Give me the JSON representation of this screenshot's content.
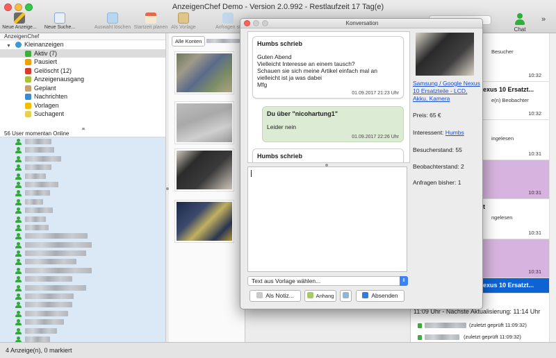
{
  "window": {
    "title": "AnzeigenChef Demo - Version 2.0.992 - Restlaufzeit 17 Tag(e)"
  },
  "toolbar": {
    "items": [
      {
        "label": "Neue Anzeige...",
        "icon": "wand-icon"
      },
      {
        "label": "Neue Suche...",
        "icon": "new-search-icon"
      },
      {
        "label": "Auswahl löschen",
        "icon": "trash-icon"
      },
      {
        "label": "Startzeit planen",
        "icon": "calendar-icon"
      },
      {
        "label": "Als Vorlage",
        "icon": "template-icon"
      },
      {
        "label": "Anfragen st",
        "icon": "send-icon"
      }
    ],
    "chat_label": "Chat",
    "more_label": "»"
  },
  "tree": {
    "header": "AnzeigenChef",
    "root": "Kleinanzeigen",
    "items": [
      {
        "label": "Aktiv (7)",
        "color": "#3fae3a"
      },
      {
        "label": "Pausiert",
        "color": "#f0a000"
      },
      {
        "label": "Gelöscht (12)",
        "color": "#d63a2a"
      },
      {
        "label": "Anzeigenausgang",
        "color": "#a9c23a"
      },
      {
        "label": "Geplant",
        "color": "#c8a06a"
      },
      {
        "label": "Nachrichten",
        "color": "#3a8ad6"
      },
      {
        "label": "Vorlagen",
        "color": "#f0c000"
      },
      {
        "label": "Suchagent",
        "color": "#e8d050"
      }
    ]
  },
  "users": {
    "header": "56 User momentan Online"
  },
  "middle": {
    "accounts_button": "Alle Konten"
  },
  "dialog": {
    "title": "Konversation",
    "messages": [
      {
        "author": "Humbs schrieb",
        "text": "Guten Abend\nVielleicht Interesse an einem tausch?\nSchauen sie sich meine Artikel einfach mal an vielleicht ist ja was dabei\nMfg",
        "time": "01.09.2017 21:23 Uhr"
      },
      {
        "author": "Du über \"nicohartung1\"",
        "text": "Leider nein",
        "time": "01.09.2017 22:26 Uhr"
      },
      {
        "author": "Humbs schrieb",
        "text": "",
        "time": ""
      }
    ],
    "template_select": "Text aus Vorlage wählen...",
    "buttons": {
      "note": "Als Notiz...",
      "attachment": "Anhang",
      "send": "Absenden"
    },
    "product": {
      "link": "Samsung / Google Nexus 10 Ersatzteile - LCD, Akku, Kamera",
      "price": "Preis: 65 €",
      "interest_label": "Interessent:",
      "interest_user": "Humbs",
      "visitors": "Besucherstand: 55",
      "watchers": "Beobachterstand: 2",
      "requests": "Anfragen bisher: 1"
    }
  },
  "right_list": {
    "entries": [
      {
        "title": "",
        "sub": "Besucher",
        "time": "10:32"
      },
      {
        "title": "exus 10 Ersatzt...",
        "sub": "e(n) Beobachter",
        "time": "10:32"
      },
      {
        "title": "",
        "sub": "ingelesen",
        "time": "10:31"
      },
      {
        "title": "",
        "sub": "",
        "time": "10:31"
      },
      {
        "title": "t",
        "sub": "ngelesen",
        "time": "10:31"
      },
      {
        "title": "",
        "sub": "",
        "time": "10:31"
      },
      {
        "title": "exus 10 Ersatzt...",
        "sub": "",
        "time": ""
      }
    ],
    "footer": "11:09 Uhr - Nächste Aktualisierung: 11:14 Uhr",
    "checked_1": "(zuletzt geprüft 11:09:32)",
    "checked_2": "(zuletzt geprüft 11:09:32)"
  },
  "status": {
    "text": "4 Anzeige(n), 0 markiert"
  }
}
